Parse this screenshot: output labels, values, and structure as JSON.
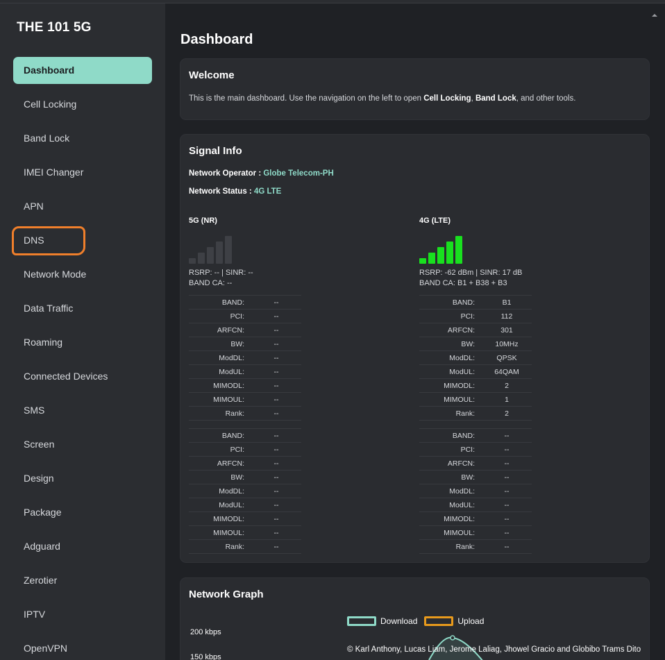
{
  "brand": "THE 101 5G",
  "nav": [
    "Dashboard",
    "Cell Locking",
    "Band Lock",
    "IMEI Changer",
    "APN",
    "DNS",
    "Network Mode",
    "Data Traffic",
    "Roaming",
    "Connected Devices",
    "SMS",
    "Screen",
    "Design",
    "Package",
    "Adguard",
    "Zerotier",
    "IPTV",
    "OpenVPN"
  ],
  "page_title": "Dashboard",
  "welcome": {
    "title": "Welcome",
    "text_a": "This is the main dashboard. Use the navigation on the left to open ",
    "link1": "Cell Locking",
    "sep": ", ",
    "link2": "Band Lock",
    "text_b": ", and other tools."
  },
  "signal": {
    "title": "Signal Info",
    "operator_label": "Network Operator : ",
    "operator_value": "Globe Telecom-PH",
    "status_label": "Network Status : ",
    "status_value": "4G LTE",
    "nr": {
      "title": "5G (NR)",
      "level": 0,
      "rsrp_line": "RSRP: -- | SINR: --",
      "ca_line": "BAND CA: --",
      "table1": [
        [
          "BAND:",
          "--"
        ],
        [
          "PCI:",
          "--"
        ],
        [
          "ARFCN:",
          "--"
        ],
        [
          "BW:",
          "--"
        ],
        [
          "ModDL:",
          "--"
        ],
        [
          "ModUL:",
          "--"
        ],
        [
          "MIMODL:",
          "--"
        ],
        [
          "MIMOUL:",
          "--"
        ],
        [
          "Rank:",
          "--"
        ]
      ],
      "table2": [
        [
          "BAND:",
          "--"
        ],
        [
          "PCI:",
          "--"
        ],
        [
          "ARFCN:",
          "--"
        ],
        [
          "BW:",
          "--"
        ],
        [
          "ModDL:",
          "--"
        ],
        [
          "ModUL:",
          "--"
        ],
        [
          "MIMODL:",
          "--"
        ],
        [
          "MIMOUL:",
          "--"
        ],
        [
          "Rank:",
          "--"
        ]
      ]
    },
    "lte": {
      "title": "4G (LTE)",
      "level": 5,
      "rsrp_line": "RSRP: -62 dBm | SINR: 17 dB",
      "ca_line": "BAND CA: B1 + B38 + B3",
      "table1": [
        [
          "BAND:",
          "B1"
        ],
        [
          "PCI:",
          "112"
        ],
        [
          "ARFCN:",
          "301"
        ],
        [
          "BW:",
          "10MHz"
        ],
        [
          "ModDL:",
          "QPSK"
        ],
        [
          "ModUL:",
          "64QAM"
        ],
        [
          "MIMODL:",
          "2"
        ],
        [
          "MIMOUL:",
          "1"
        ],
        [
          "Rank:",
          "2"
        ]
      ],
      "table2": [
        [
          "BAND:",
          "--"
        ],
        [
          "PCI:",
          "--"
        ],
        [
          "ARFCN:",
          "--"
        ],
        [
          "BW:",
          "--"
        ],
        [
          "ModDL:",
          "--"
        ],
        [
          "ModUL:",
          "--"
        ],
        [
          "MIMODL:",
          "--"
        ],
        [
          "MIMOUL:",
          "--"
        ],
        [
          "Rank:",
          "--"
        ]
      ]
    }
  },
  "graph": {
    "title": "Network Graph",
    "legend_download": "Download",
    "legend_upload": "Upload",
    "ytick_top": "200 kbps",
    "ytick_second": "150 kbps"
  },
  "footer": "© Karl Anthony, Lucas Liam, Jerome Laliag, Jhowel Gracio and Globibo Trams Dito",
  "colors": {
    "accent": "#8fdac8",
    "signal_on": "#19e01f",
    "signal_off": "#3e4045",
    "upload": "#e89a1c",
    "highlight": "#f07f2b"
  }
}
